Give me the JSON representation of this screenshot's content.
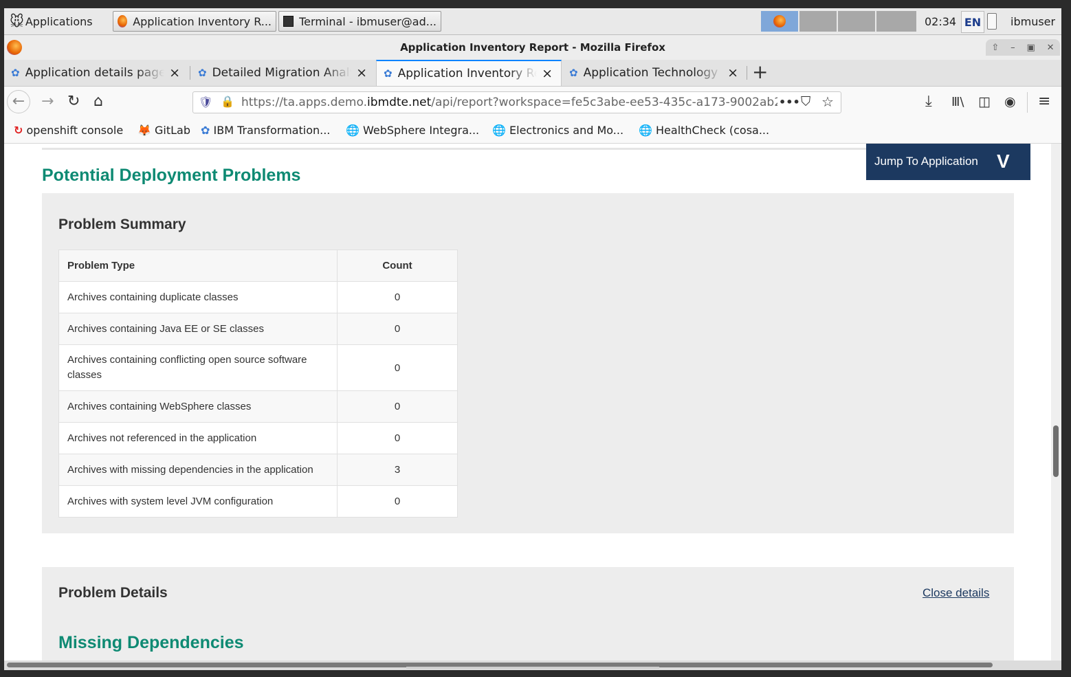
{
  "taskbar": {
    "applications_label": "Applications",
    "windows": [
      "Application Inventory R...",
      "Terminal - ibmuser@ad..."
    ],
    "clock": "02:34",
    "keyboard_layout": "EN",
    "user": "ibmuser"
  },
  "window": {
    "title": "Application Inventory Report - Mozilla Firefox"
  },
  "tabs": [
    {
      "label": "Application details page"
    },
    {
      "label": "Detailed Migration Analysis"
    },
    {
      "label": "Application Inventory Report"
    },
    {
      "label": "Application Technology Evaluation"
    }
  ],
  "urlbar": {
    "url_prefix": "https://ta.apps.demo.",
    "url_domain": "ibmdte.net",
    "url_suffix": "/api/report?workspace=fe5c3abe-ee53-435c-a173-9002ab2",
    "more_label": "•••"
  },
  "bookmarks": [
    {
      "label": "openshift console",
      "icon": "openshift-icon"
    },
    {
      "label": "GitLab",
      "icon": "gitlab-icon"
    },
    {
      "label": "IBM Transformation...",
      "icon": "ibm-icon"
    },
    {
      "label": "WebSphere Integra...",
      "icon": "globe-icon"
    },
    {
      "label": "Electronics and Mo...",
      "icon": "globe-icon"
    },
    {
      "label": "HealthCheck (cosa...",
      "icon": "globe-icon"
    }
  ],
  "page": {
    "section_title": "Potential Deployment Problems",
    "jump_label": "Jump To Application",
    "summary": {
      "title": "Problem Summary",
      "columns": [
        "Problem Type",
        "Count"
      ],
      "rows": [
        {
          "type": "Archives containing duplicate classes",
          "count": "0"
        },
        {
          "type": "Archives containing Java EE or SE classes",
          "count": "0"
        },
        {
          "type": "Archives containing conflicting open source software classes",
          "count": "0"
        },
        {
          "type": "Archives containing WebSphere classes",
          "count": "0"
        },
        {
          "type": "Archives not referenced in the application",
          "count": "0"
        },
        {
          "type": "Archives with missing dependencies in the application",
          "count": "3"
        },
        {
          "type": "Archives with system level JVM configuration",
          "count": "0"
        }
      ]
    },
    "details": {
      "title": "Problem Details",
      "close_label": "Close details",
      "subsection_title": "Missing Dependencies"
    }
  },
  "colors": {
    "accent_green": "#0e8a73",
    "jump_bg": "#1c3960",
    "tab_active": "#0a84ff"
  }
}
